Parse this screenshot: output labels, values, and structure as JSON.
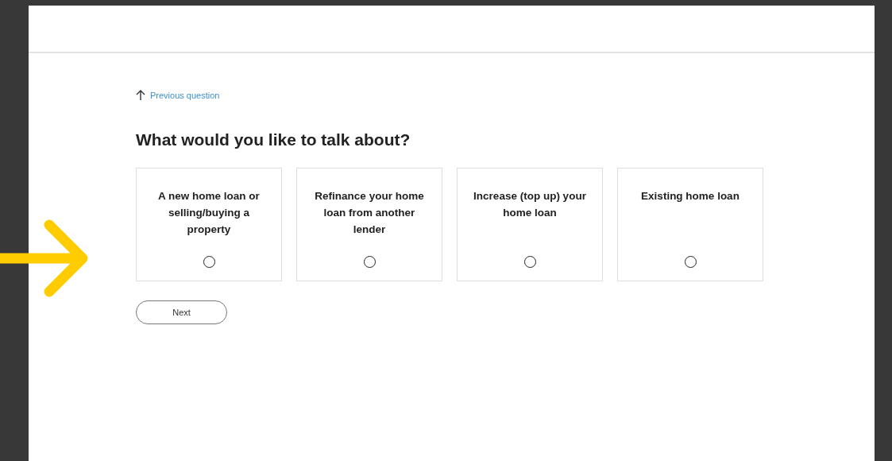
{
  "back_link": {
    "label": "Previous question"
  },
  "question": "What would you like to talk about?",
  "options": [
    {
      "label": "A new home loan or selling/buying a property",
      "selected": false
    },
    {
      "label": "Refinance your home loan from another lender",
      "selected": false
    },
    {
      "label": "Increase (top up) your home loan",
      "selected": false
    },
    {
      "label": "Existing home loan",
      "selected": false
    }
  ],
  "next_button": {
    "label": "Next"
  }
}
